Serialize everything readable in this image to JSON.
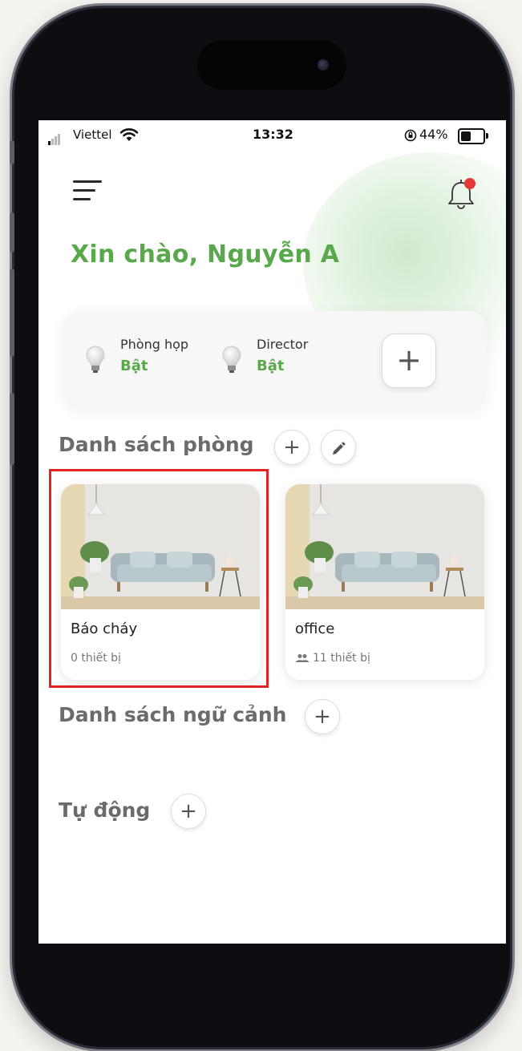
{
  "status_bar": {
    "carrier": "Viettel",
    "time": "13:32",
    "battery": "44%",
    "icons": [
      "signal-icon",
      "wifi-icon",
      "orientation-lock-icon",
      "battery-icon"
    ]
  },
  "header": {
    "greeting": "Xin chào, Nguyễn A",
    "icons": [
      "menu-icon",
      "bell-icon"
    ],
    "notification_badge_color": "#e53935"
  },
  "quick_devices": {
    "items": [
      {
        "name": "Phòng họp",
        "state": "Bật"
      },
      {
        "name": "Director",
        "state": "Bật"
      }
    ],
    "add_label": "+"
  },
  "rooms": {
    "title": "Danh sách phòng",
    "add_label": "+",
    "items": [
      {
        "name": "Báo cháy",
        "count": "0 thiết bị",
        "selected": true
      },
      {
        "name": "office",
        "count": "11 thiết bị",
        "selected": false
      }
    ]
  },
  "scenes": {
    "title": "Danh sách ngữ cảnh",
    "add_label": "+"
  },
  "automation": {
    "title": "Tự động",
    "add_label": "+"
  },
  "colors": {
    "accent_green": "#5aa84c",
    "highlight_red": "#e02424",
    "section_text": "#6b6b6b"
  }
}
